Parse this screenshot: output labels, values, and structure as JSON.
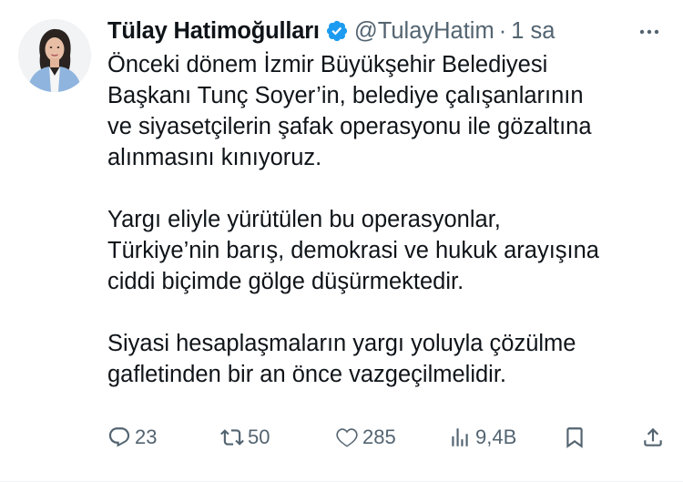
{
  "author": {
    "display_name": "Tülay Hatimoğulları",
    "handle": "@TulayHatim",
    "separator": "·",
    "time": "1 sa",
    "verified_color": "#1d9bf0"
  },
  "tweet": {
    "paragraphs": [
      "Önceki dönem İzmir Büyükşehir Belediyesi\nBaşkanı Tunç Soyer’in, belediye çalışanlarının\nve siyasetçilerin şafak operasyonu ile gözaltına\nalınmasını kınıyoruz.",
      "Yargı eliyle yürütülen bu operasyonlar,\nTürkiye’nin barış, demokrasi ve hukuk arayışına\nciddi biçimde gölge düşürmektedir.",
      "Siyasi hesaplaşmaların yargı yoluyla çözülme\ngafletinden bir an önce vazgeçilmelidir."
    ]
  },
  "actions": {
    "replies": "23",
    "retweets": "50",
    "likes": "285",
    "views": "9,4B"
  },
  "icons": {
    "reply": "reply-icon",
    "retweet": "retweet-icon",
    "like": "heart-icon",
    "views": "views-icon",
    "bookmark": "bookmark-icon",
    "share": "share-icon",
    "more": "more-icon"
  },
  "colors": {
    "text": "#0f1419",
    "secondary": "#536471",
    "accent": "#1d9bf0"
  }
}
